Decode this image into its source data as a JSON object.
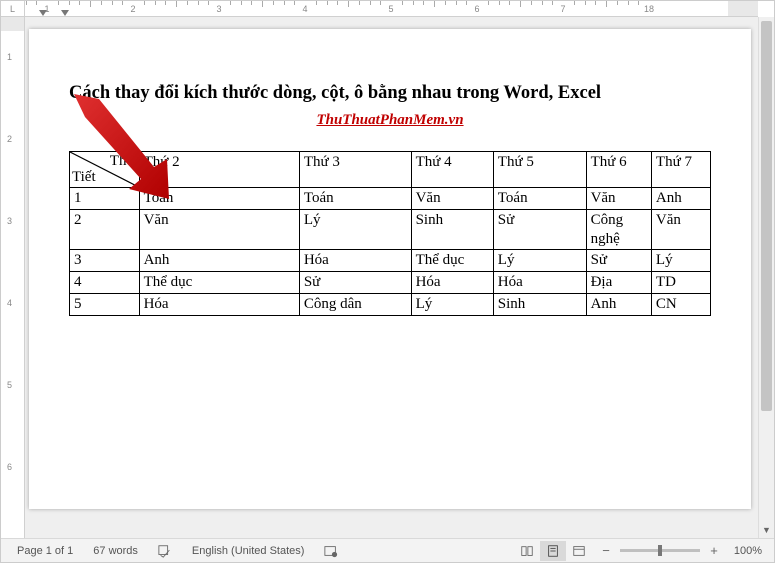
{
  "ruler": {
    "corner": "L",
    "hlabels": [
      "1",
      "2",
      "3",
      "4",
      "5",
      "6",
      "7",
      "18"
    ],
    "vlabels": [
      "1",
      "2",
      "3",
      "4",
      "5",
      "6"
    ]
  },
  "document": {
    "title": "Cách thay đổi kích thước dòng, cột, ô bằng nhau trong Word, Excel",
    "subtitle": "ThuThuatPhanMem.vn",
    "table": {
      "header_top": "Thứ",
      "header_left": "Tiết",
      "cols": [
        "Thứ 2",
        "Thứ 3",
        "Thứ 4",
        "Thứ 5",
        "Thứ 6",
        "Thứ 7"
      ],
      "rows": [
        {
          "n": "1",
          "cells": [
            "Toán",
            "Toán",
            "Văn",
            "Toán",
            "Văn",
            "Anh"
          ]
        },
        {
          "n": "2",
          "cells": [
            "Văn",
            "Lý",
            "Sinh",
            "Sử",
            "Công nghệ",
            "Văn"
          ]
        },
        {
          "n": "3",
          "cells": [
            "Anh",
            "Hóa",
            "Thể dục",
            "Lý",
            "Sử",
            "Lý"
          ]
        },
        {
          "n": "4",
          "cells": [
            "Thể dục",
            "Sử",
            "Hóa",
            "Hóa",
            "Địa",
            "TD"
          ]
        },
        {
          "n": "5",
          "cells": [
            "Hóa",
            "Công dân",
            "Lý",
            "Sinh",
            "Anh",
            "CN"
          ]
        }
      ]
    }
  },
  "status": {
    "page": "Page 1 of 1",
    "words": "67 words",
    "lang": "English (United States)",
    "zoom": "100%"
  }
}
